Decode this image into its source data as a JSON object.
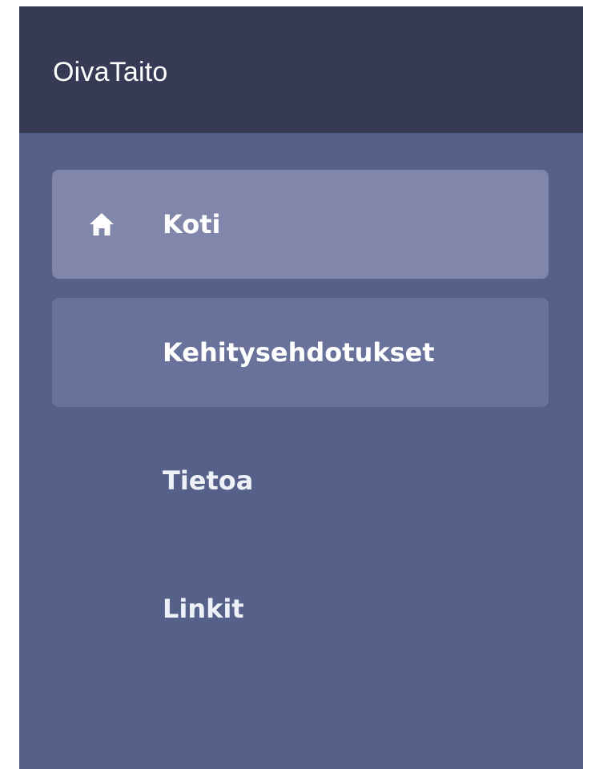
{
  "app": {
    "brand": "OivaTaito"
  },
  "sidebar": {
    "items": [
      {
        "label": "Koti",
        "icon": "home-icon",
        "state": "active"
      },
      {
        "label": "Kehitysehdotukset",
        "icon": "",
        "state": "hover"
      },
      {
        "label": "Tietoa",
        "icon": "",
        "state": "normal"
      },
      {
        "label": "Linkit",
        "icon": "",
        "state": "normal"
      }
    ]
  },
  "colors": {
    "header": "#373a55",
    "sidebar": "#56618a",
    "active_item": "#8087aa",
    "hover_item": "#69729a",
    "text": "#ffffff"
  }
}
